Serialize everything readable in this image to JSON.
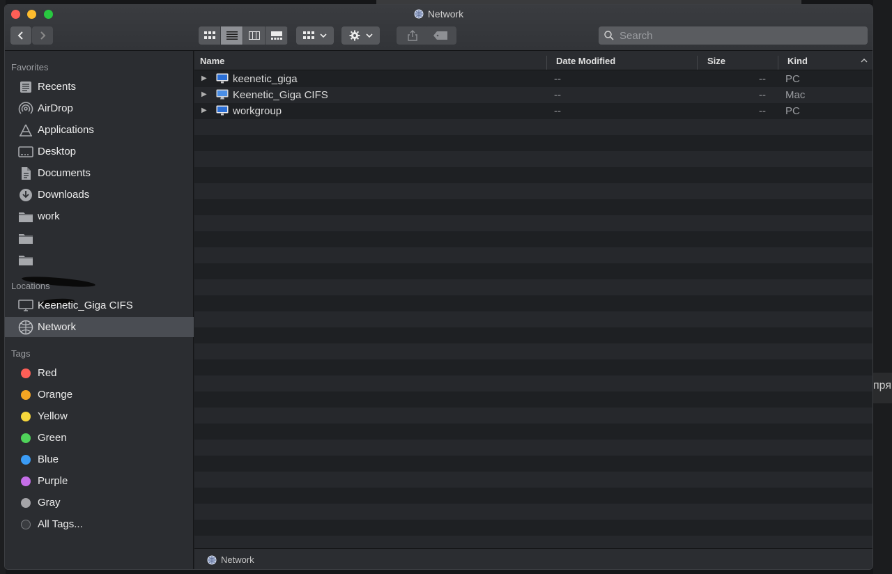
{
  "window": {
    "title": "Network"
  },
  "toolbar": {
    "search_placeholder": "Search"
  },
  "sidebar": {
    "favorites_label": "Favorites",
    "favorites": [
      {
        "label": "Recents",
        "icon": "clock-icon"
      },
      {
        "label": "AirDrop",
        "icon": "airdrop-icon"
      },
      {
        "label": "Applications",
        "icon": "applications-icon"
      },
      {
        "label": "Desktop",
        "icon": "desktop-icon"
      },
      {
        "label": "Documents",
        "icon": "document-icon"
      },
      {
        "label": "Downloads",
        "icon": "download-icon"
      },
      {
        "label": "work",
        "icon": "folder-icon"
      }
    ],
    "locations_label": "Locations",
    "locations": [
      {
        "label": "Keenetic_Giga CIFS",
        "icon": "monitor-icon"
      },
      {
        "label": "Network",
        "icon": "network-globe-icon"
      }
    ],
    "tags_label": "Tags",
    "tags": [
      {
        "label": "Red",
        "color": "#fe5f57"
      },
      {
        "label": "Orange",
        "color": "#f5a623"
      },
      {
        "label": "Yellow",
        "color": "#f8d83c"
      },
      {
        "label": "Green",
        "color": "#4fd35a"
      },
      {
        "label": "Blue",
        "color": "#3b9cf6"
      },
      {
        "label": "Purple",
        "color": "#c56ee8"
      },
      {
        "label": "Gray",
        "color": "#a4a4a8"
      },
      {
        "label": "All Tags...",
        "color": "#3a3c40"
      }
    ]
  },
  "list": {
    "columns": {
      "name": "Name",
      "date": "Date Modified",
      "size": "Size",
      "kind": "Kind"
    },
    "rows": [
      {
        "name": "keenetic_giga",
        "date": "--",
        "size": "--",
        "kind": "PC"
      },
      {
        "name": "Keenetic_Giga CIFS",
        "date": "--",
        "size": "--",
        "kind": "Mac"
      },
      {
        "name": "workgroup",
        "date": "--",
        "size": "--",
        "kind": "PC"
      }
    ]
  },
  "pathbar": {
    "label": "Network"
  },
  "background": {
    "right_text": "пря"
  }
}
